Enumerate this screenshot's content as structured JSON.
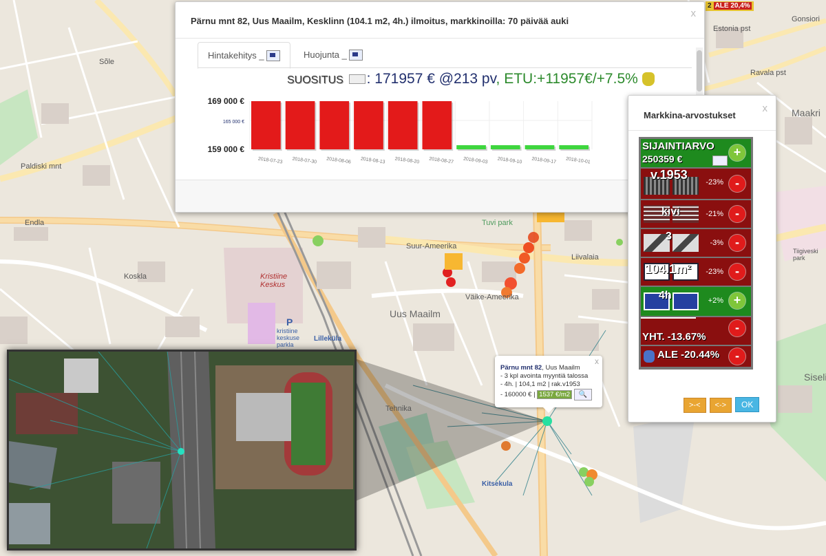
{
  "map": {
    "labels": {
      "uus_maailm": "Uus Maailm",
      "kristiine": "Kristiine\nKeskus",
      "kristiine_parkla": "kristiine\nkeskuse\nparkla",
      "lillekula": "Lilleküla",
      "tuvi_park": "Tuvi park",
      "kitsekula": "Kitsekula",
      "maakri": "Maakri",
      "siselin": "Siselin",
      "tiigiveski": "Tiigiveski\npark",
      "endla": "Endla",
      "suur_ameerika": "Suur-Ameerika",
      "liivalaia": "Liivalaia",
      "vaike_ameerika": "Väike-Ameerika",
      "tehnika": "Tehnika",
      "koskla": "Koskla",
      "parnu_mnt": "Pärnu mnt",
      "paldiski": "Paldiski mnt",
      "sole": "Sõle",
      "ravala": "Ravala pst",
      "gonsiori": "Gonsiori",
      "estonia": "Estonia pst",
      "parking": "P"
    }
  },
  "top_badge": {
    "num": "2",
    "text": "ALE 20,4%"
  },
  "price_popup": {
    "title": "Pärnu mnt 82, Uus Maailm, Kesklinn (104.1 m2, 4h.) ilmoitus, markkinoilla: 70 päivää auki",
    "close": "x",
    "tabs": [
      {
        "label": "Hintakehitys _"
      },
      {
        "label": "Huojunta _"
      }
    ],
    "suositus_label": "SUOSITUS",
    "suositus_value": ": 171957 € @213 pv",
    "etu": ", ETU:+11957€/+7.5%",
    "nav_button": ">-"
  },
  "chart_data": {
    "type": "bar",
    "categories": [
      "2018-07-23",
      "2018-07-30",
      "2018-08-06",
      "2018-08-13",
      "2018-08-20",
      "2018-08-27",
      "2018-09-03",
      "2018-09-10",
      "2018-09-17",
      "2018-10-01"
    ],
    "series": [
      {
        "values": [
          169000,
          169000,
          169000,
          169000,
          169000,
          169000,
          160000,
          160000,
          160000,
          160000
        ]
      }
    ],
    "ylim": [
      159000,
      169000
    ],
    "yticks": [
      "169 000 €",
      "165 000 €",
      "159 000 €"
    ],
    "colors": {
      "high": "#e31a1a",
      "low": "#3ed63e"
    }
  },
  "valuation_popup": {
    "title": "Markkina-arvostukset",
    "close": "x",
    "rows": [
      {
        "label": "SIJAINTIARVO",
        "sub": "250359 €",
        "pct": "",
        "sign": "+",
        "tone": "green"
      },
      {
        "label": "v.1953",
        "pct": "-23%",
        "sign": "-",
        "tone": "red"
      },
      {
        "label": "kivi",
        "pct": "-21%",
        "sign": "-",
        "tone": "red"
      },
      {
        "label": "3",
        "pct": "-3%",
        "sign": "-",
        "tone": "red"
      },
      {
        "label": "104.1m²",
        "pct": "-23%",
        "sign": "-",
        "tone": "red"
      },
      {
        "label": "4h",
        "pct": "+2%",
        "sign": "+",
        "tone": "green"
      },
      {
        "label": "YHT. -13.67%",
        "pct": "",
        "sign": "-",
        "tone": "red"
      },
      {
        "label": "ALE -20.44%",
        "pct": "",
        "sign": "-",
        "tone": "red"
      }
    ],
    "buttons": {
      "b1": ">-<",
      "b2": "<->",
      "ok": "OK"
    }
  },
  "tooltip": {
    "address_bold": "Pärnu mnt 82",
    "address_rest": ", Uus Maailm",
    "line1": "- 3 kpl avointa myyntiä talossa",
    "line2": "- 4h. | 104,1 m2 | rak.v1953",
    "line3": "- 160000 € |",
    "badge": "1537 €/m2",
    "close": "x"
  }
}
